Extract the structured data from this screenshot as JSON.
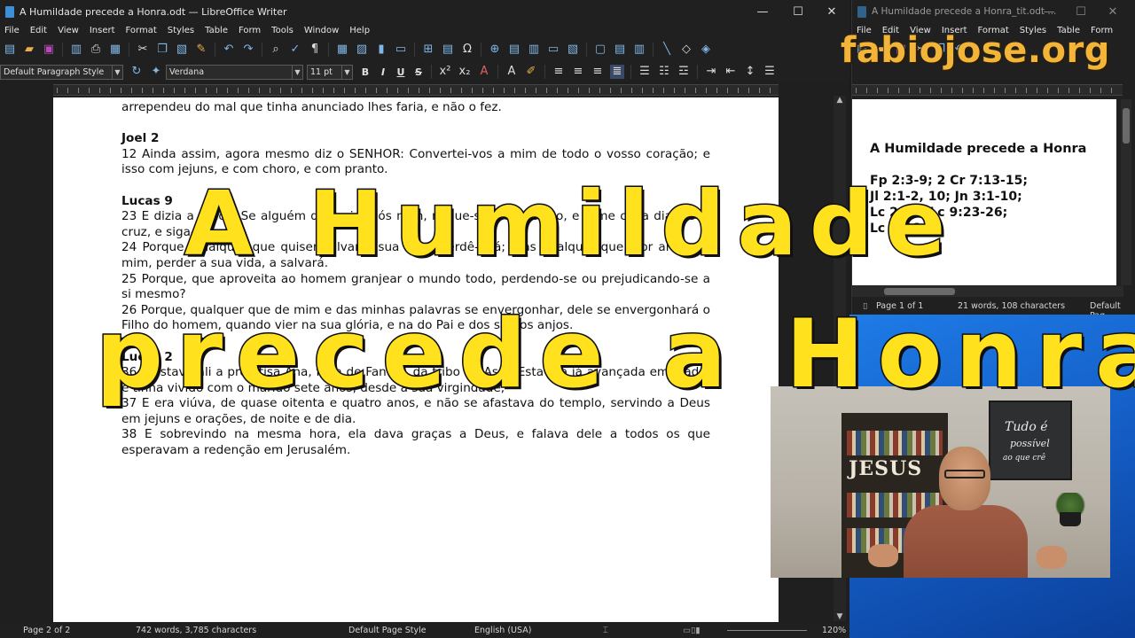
{
  "main_window": {
    "title": "A Humildade precede a Honra.odt — LibreOffice Writer",
    "window_controls": [
      "—",
      "☐",
      "✕"
    ],
    "menu": [
      "File",
      "Edit",
      "View",
      "Insert",
      "Format",
      "Styles",
      "Table",
      "Form",
      "Tools",
      "Window",
      "Help"
    ],
    "formatting": {
      "paragraph_style": "Default Paragraph Style",
      "font_name": "Verdana",
      "font_size": "11 pt",
      "bold": "B",
      "italic": "I",
      "underline": "U",
      "strike": "S"
    },
    "document": {
      "line_top": "arrependeu do mal que tinha anunciado lhes faria, e não o fez.",
      "joel_heading": "Joel 2",
      "joel_12": "12 Ainda assim, agora mesmo diz o SENHOR: Convertei-vos a mim de todo o vosso coração; e isso com jejuns, e com choro, e com pranto.",
      "lucas_heading": "Lucas 9",
      "lucas_23": "23 E dizia a todos: Se alguém quer vir após mim, negue-se a si mesmo, e tome cada dia a sua cruz, e siga-me.",
      "lucas_24": "24 Porque, qualquer que quiser salvar a sua vida, perdê-la-á; mas qualquer que, por amor de mim, perder a sua vida, a salvará.",
      "lucas_25": "25 Porque, que aproveita ao homem granjear o mundo todo, perdendo-se ou prejudicando-se a si mesmo?",
      "lucas_26": "26 Porque, qualquer que de mim e das minhas palavras se envergonhar, dele se envergonhará o Filho do homem, quando vier na sua glória, e na do Pai e dos santos anjos.",
      "lucas2_heading": "Lucas 2",
      "lucas2_36": "36 E estava ali a profetisa Ana, filha de Fanuel, da tribo de Aser. Esta era já avançada em idade, e tinha vivido com o marido sete anos, desde a sua virgindade;",
      "lucas2_37": "37 E era viúva, de quase oitenta e quatro anos, e não se afastava do templo, servindo a Deus em jejuns e orações, de noite e de dia.",
      "lucas2_38": "38 E sobrevindo na mesma hora, ela dava graças a Deus, e falava dele a todos os que esperavam a redenção em Jerusalém."
    },
    "status": {
      "page": "Page 2 of 2",
      "words": "742 words, 3,785 characters",
      "page_style": "Default Page Style",
      "language": "English (USA)",
      "zoom": "120%"
    }
  },
  "side_window": {
    "title": "A Humildade precede a Honra_tit.odt ...",
    "window_controls": [
      "—",
      "☐",
      "✕"
    ],
    "menu": [
      "File",
      "Edit",
      "View",
      "Insert",
      "Format",
      "Styles",
      "Table",
      "Form"
    ],
    "document": {
      "title": "A Humildade precede a Honra",
      "line1": "Fp 2:3-9; 2 Cr 7:13-15;",
      "line2": "Jl 2:1-2, 10; Jn 3:1-10;",
      "line3": "Lc 2:12; Lc 9:23-26;",
      "line4": "Lc 2:36-38"
    },
    "status": {
      "page": "Page 1 of 1",
      "words": "21 words, 108 characters",
      "page_style": "Default Pag"
    }
  },
  "overlay": {
    "title_line1": "A Humildade",
    "title_line2": "precede a Honra",
    "brand": "fabiojose.org",
    "title_color": "#ffe11d",
    "brand_color": "#f2b53a"
  },
  "webcam": {
    "sign_jesus": "JESUS",
    "frame_line1": "Tudo é",
    "frame_line2": "possível",
    "frame_line3": "ao que crê"
  }
}
